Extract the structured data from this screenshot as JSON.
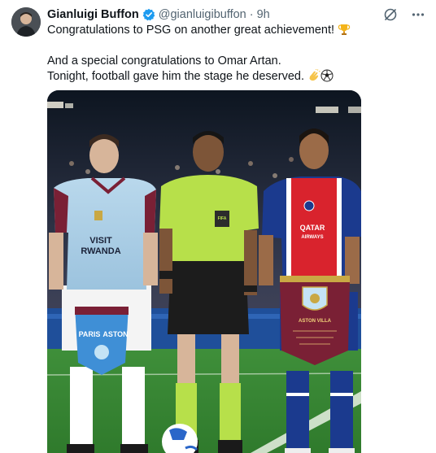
{
  "post": {
    "author_name": "Gianluigi Buffon",
    "author_handle": "@gianluigibuffon",
    "separator": "·",
    "time": "9h",
    "lines": [
      "Congratulations to PSG on another great achievement!",
      "",
      "And a special congratulations to Omar Artan.",
      "Tonight, football gave him the stage he deserved."
    ],
    "icons": {
      "line1_emoji": "trophy-icon",
      "line4_emoji": [
        "clapping-hands-icon",
        "soccer-ball-icon"
      ],
      "verified": "verified-badge-icon",
      "grok": "grok-icon",
      "more": "more-options-icon"
    }
  },
  "photo": {
    "left_shirt": {
      "line1": "VISIT",
      "line2": "RWANDA"
    },
    "right_shirt": {
      "line1": "QATAR",
      "line2": "AIRWAYS"
    },
    "pennant_left": {
      "line1": "PARIS",
      "line2": "ASTON"
    },
    "pennant_right_text": "ASTON VILLA",
    "referee_badge": "FIFA"
  },
  "colors": {
    "verified_blue": "#1d9bf0",
    "text_secondary": "#536471",
    "referee_green": "#b7e04a",
    "villa_claret": "#7a2035",
    "villa_light_blue": "#a9cfe8",
    "psg_red": "#d9232d",
    "psg_blue": "#1b3a8e"
  }
}
